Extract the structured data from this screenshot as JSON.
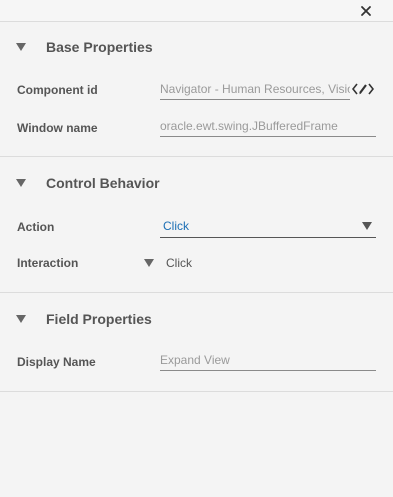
{
  "window": {
    "close_icon": "close-icon"
  },
  "base_properties": {
    "title": "Base Properties",
    "component_id_label": "Component id",
    "component_id_value": "Navigator - Human Resources, Visio",
    "window_name_label": "Window name",
    "window_name_value": "oracle.ewt.swing.JBufferedFrame",
    "edit_icon": "edit-code-icon"
  },
  "control_behavior": {
    "title": "Control Behavior",
    "action_label": "Action",
    "action_value": "Click",
    "interaction_label": "Interaction",
    "interaction_value": "Click"
  },
  "field_properties": {
    "title": "Field Properties",
    "display_name_label": "Display Name",
    "display_name_value": "Expand View"
  },
  "colors": {
    "accent": "#1c6fb5",
    "text": "#555555",
    "muted": "#9a9a9a",
    "background": "#f4f4f4",
    "divider": "#dcdcdc"
  }
}
